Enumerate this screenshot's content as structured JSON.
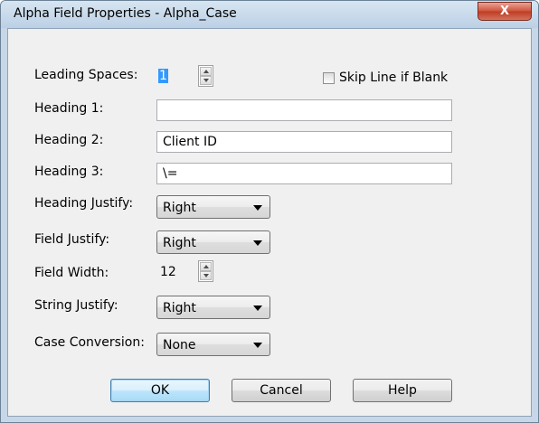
{
  "window": {
    "title": "Alpha Field Properties - Alpha_Case",
    "close_glyph": "X"
  },
  "fields": {
    "leading_spaces": {
      "label": "Leading Spaces:",
      "value": "1"
    },
    "skip_line": {
      "label": "Skip Line if Blank",
      "checked": false
    },
    "heading1": {
      "label": "Heading 1:",
      "value": ""
    },
    "heading2": {
      "label": "Heading 2:",
      "value": "Client ID"
    },
    "heading3": {
      "label": "Heading 3:",
      "value": "\\="
    },
    "heading_justify": {
      "label": "Heading Justify:",
      "value": "Right"
    },
    "field_justify": {
      "label": "Field Justify:",
      "value": "Right"
    },
    "field_width": {
      "label": "Field Width:",
      "value": "12"
    },
    "string_justify": {
      "label": "String Justify:",
      "value": "Right"
    },
    "case_conversion": {
      "label": "Case Conversion:",
      "value": "None"
    }
  },
  "buttons": {
    "ok": "OK",
    "cancel": "Cancel",
    "help": "Help"
  }
}
